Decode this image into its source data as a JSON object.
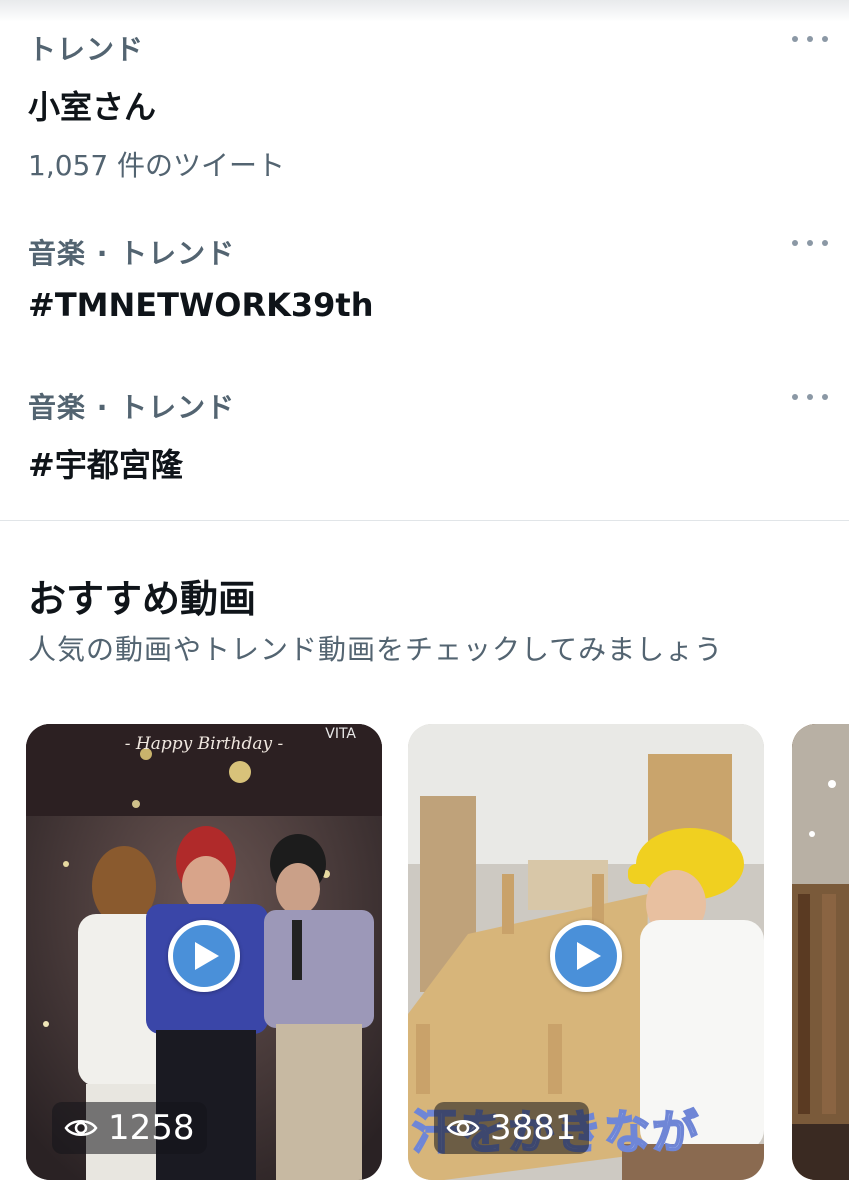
{
  "trends": [
    {
      "category": "トレンド",
      "name": "小室さん",
      "count": "1,057 件のツイート"
    },
    {
      "category": "音楽 · トレンド",
      "name": "#TMNETWORK39th"
    },
    {
      "category": "音楽 · トレンド",
      "name": "#宇都宮隆"
    }
  ],
  "recommended": {
    "title": "おすすめ動画",
    "subtitle": "人気の動画やトレンド動画をチェックしてみましょう"
  },
  "videos": [
    {
      "banner": "- Happy Birthday -",
      "watermark": "VITA",
      "views": "1258"
    },
    {
      "caption": "汗をかきなが",
      "views": "3881"
    },
    {
      "views": ""
    }
  ],
  "icons": {
    "more": "more-horizontal-icon",
    "play": "play-icon",
    "views": "eye-icon"
  },
  "colors": {
    "play_button": "#4a90d9",
    "secondary_text": "#536471"
  }
}
